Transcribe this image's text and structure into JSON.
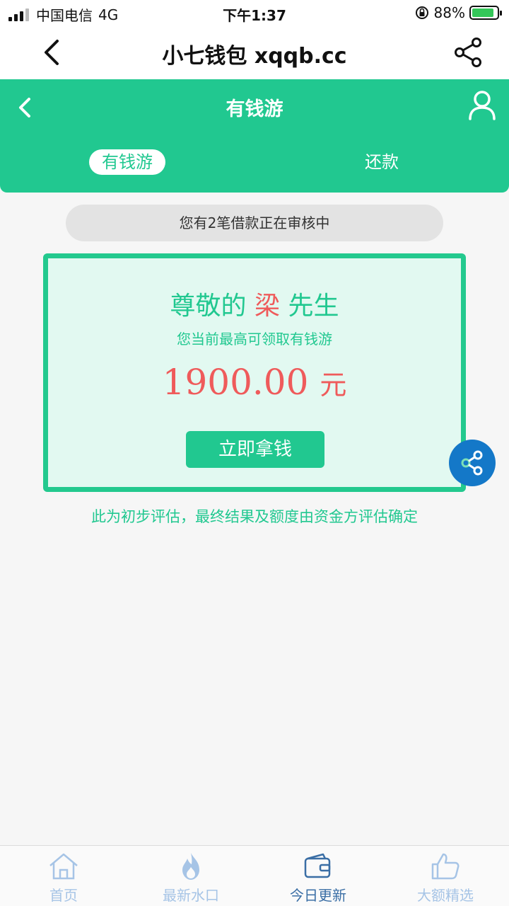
{
  "status_bar": {
    "carrier": "中国电信",
    "network": "4G",
    "time": "下午1:37",
    "battery": "88%",
    "battery_level": 0.88
  },
  "nav": {
    "title": "小七钱包 xqqb.cc",
    "back_icon": "chevron-left-icon",
    "share_icon": "share-icon"
  },
  "header": {
    "title": "有钱游",
    "tabs": [
      {
        "label": "有钱游",
        "active": true
      },
      {
        "label": "还款",
        "active": false
      }
    ],
    "user_icon": "user-icon"
  },
  "notice": "您有2笔借款正在审核中",
  "card": {
    "greeting_prefix": "尊敬的",
    "name": "梁",
    "greeting_suffix": "先生",
    "subtitle": "您当前最高可领取有钱游",
    "amount": "1900.00",
    "unit": "元",
    "button": "立即拿钱"
  },
  "footnote": "此为初步评估，最终结果及额度由资金方评估确定",
  "tabbar": [
    {
      "label": "首页",
      "icon": "home-icon",
      "active": false
    },
    {
      "label": "最新水口",
      "icon": "flame-icon",
      "active": false
    },
    {
      "label": "今日更新",
      "icon": "wallet-icon",
      "active": true
    },
    {
      "label": "大额精选",
      "icon": "thumbs-up-icon",
      "active": false
    }
  ],
  "colors": {
    "brand_green": "#21c890",
    "accent_red": "#ef5b5b",
    "share_blue": "#1478c8",
    "tab_active": "#3a6ea5",
    "tab_inactive": "#a6c4e6"
  }
}
